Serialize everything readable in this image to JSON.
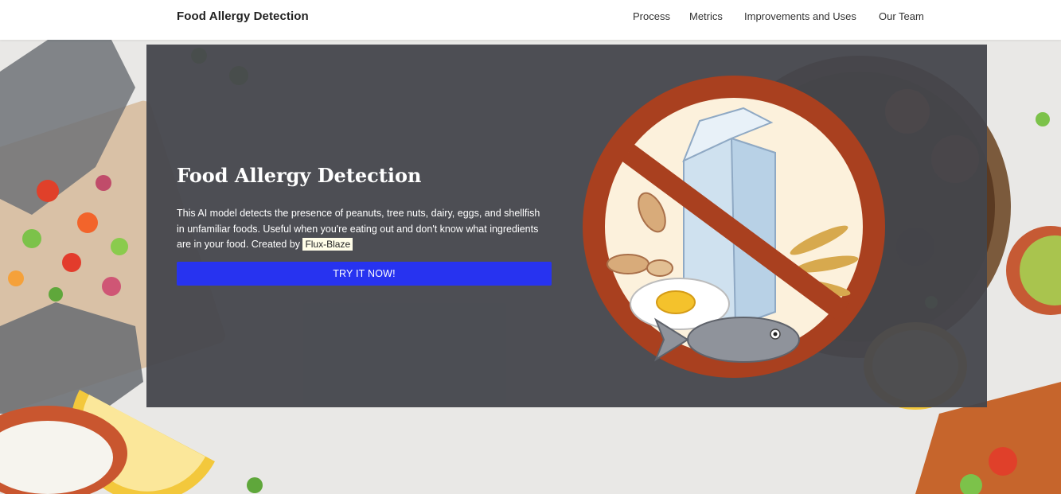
{
  "navbar": {
    "brand": "Food Allergy Detection",
    "links": [
      {
        "label": "Process"
      },
      {
        "label": "Metrics"
      },
      {
        "label": "Improvements and Uses"
      },
      {
        "label": "Our Team"
      }
    ]
  },
  "hero": {
    "title": "Food Allergy Detection",
    "description": "This AI model detects the presence of peanuts, tree nuts, dairy, eggs, and shellfish in unfamiliar foods. Useful when you're eating out and don't know what ingredients are in your food. Created by",
    "author": "Flux-Blaze",
    "cta_label": "TRY IT NOW!"
  },
  "colors": {
    "cta": "#2733f0",
    "panel": "#44464c",
    "prohibition_ring": "#a9401f"
  },
  "illustration": {
    "icon": "no-allergens-icon"
  }
}
